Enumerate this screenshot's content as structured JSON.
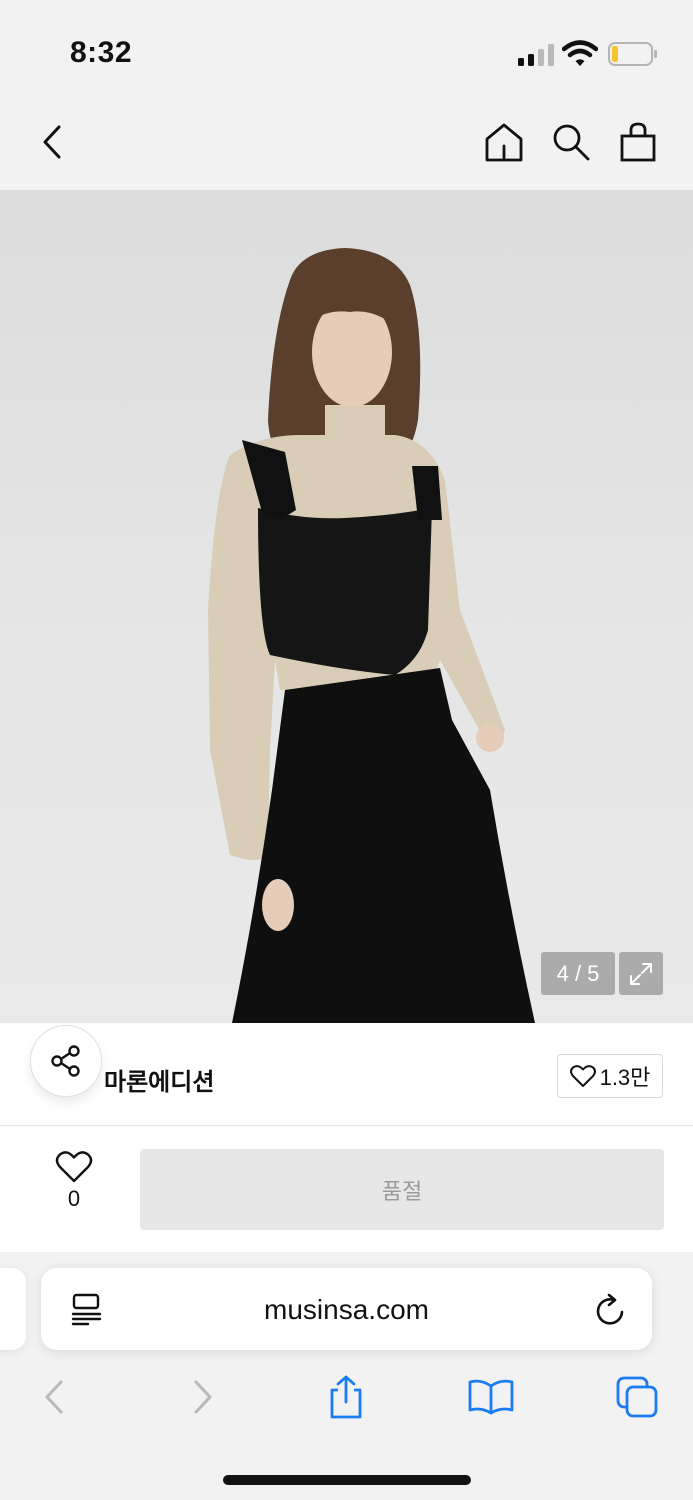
{
  "status_bar": {
    "time": "8:32"
  },
  "product": {
    "image_counter": "4 / 5",
    "brand_name": "마론에디션",
    "brand_likes": "1.3만",
    "like_count": "0",
    "soldout_label": "품절"
  },
  "safari": {
    "url": "musinsa.com"
  },
  "colors": {
    "accent": "#1a7cf0",
    "soldout_bg": "#e7e7e7",
    "soldout_text": "#9b9b9b"
  }
}
